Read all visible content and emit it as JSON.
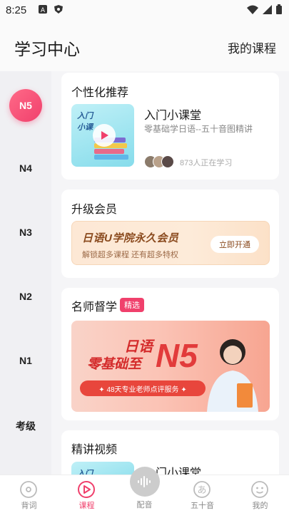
{
  "status": {
    "time": "8:25"
  },
  "header": {
    "title": "学习中心",
    "my_courses": "我的课程"
  },
  "levels": {
    "active": "N5",
    "items": [
      "N4",
      "N3",
      "N2",
      "N1",
      "考级"
    ]
  },
  "recommend": {
    "title": "个性化推荐",
    "thumb_label_1": "入门",
    "thumb_label_2": "小课",
    "course_title": "入门小课堂",
    "course_sub": "零基础学日语--五十音图精讲",
    "learners": "873人正在学习"
  },
  "vip": {
    "title": "升级会员",
    "banner_title": "日语U学院永久会员",
    "banner_sub": "解锁超多课程 还有超多特权",
    "button": "立即开通"
  },
  "mentor": {
    "title": "名师督学",
    "badge": "精选",
    "promo_line1": "日语",
    "promo_line2": "零基础至",
    "promo_n5": "N5",
    "promo_bar": "✦ 48天专业老师点评服务 ✦"
  },
  "video": {
    "title": "精讲视频",
    "thumb_label": "入门",
    "course_title": "入门小课堂"
  },
  "tabs": [
    {
      "label": "背词"
    },
    {
      "label": "课程"
    },
    {
      "label": "配音"
    },
    {
      "label": "五十音"
    },
    {
      "label": "我的"
    }
  ],
  "colors": {
    "accent": "#f0406c",
    "vip_text": "#8a4a1e",
    "promo_red": "#d42b2b"
  }
}
